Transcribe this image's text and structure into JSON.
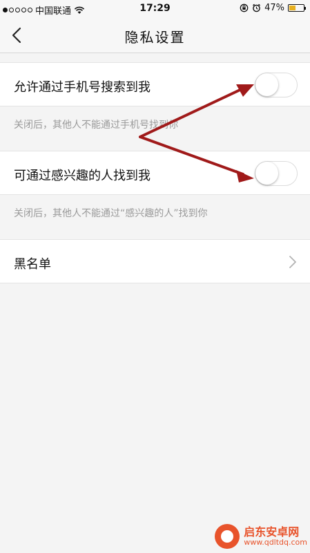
{
  "status_bar": {
    "carrier": "中国联通",
    "time": "17:29",
    "battery": "47%",
    "battery_level": 0.47,
    "signal_dots_filled": 1
  },
  "nav": {
    "title": "隐私设置"
  },
  "settings": {
    "phone_search": {
      "label": "允许通过手机号搜索到我",
      "hint": "关闭后，其他人不能通过手机号找到你",
      "enabled": false
    },
    "interest_search": {
      "label": "可通过感兴趣的人找到我",
      "hint": "关闭后，其他人不能通过“感兴趣的人”找到你",
      "enabled": false
    },
    "blacklist": {
      "label": "黑名单"
    }
  },
  "watermark": {
    "name": "启东安卓网",
    "url": "www.qdltdq.com"
  },
  "colors": {
    "annotation_arrow": "#a01a1a",
    "watermark": "#e8532b"
  }
}
